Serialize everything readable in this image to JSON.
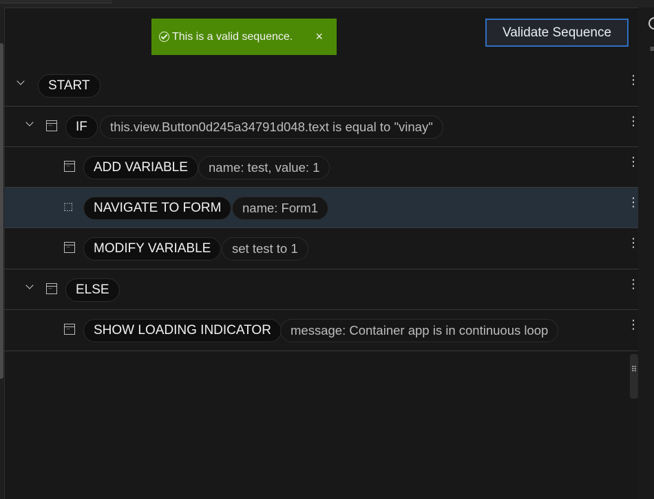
{
  "toast": {
    "message": "This is a valid sequence.",
    "close_glyph": "×",
    "icon": "check-circle-icon",
    "color": "#4c8a06"
  },
  "validate_button": {
    "label": "Validate Sequence",
    "border_color": "#2f6fc4"
  },
  "rows": [
    {
      "name": "START",
      "param": ""
    },
    {
      "name": "IF",
      "param": "this.view.Button0d245a34791d048.text is equal to \"vinay\""
    },
    {
      "name": "ADD VARIABLE",
      "param": "name: test, value: 1"
    },
    {
      "name": "NAVIGATE TO FORM",
      "param": "name: Form1"
    },
    {
      "name": "MODIFY VARIABLE",
      "param": "set test to 1"
    },
    {
      "name": "ELSE",
      "param": ""
    },
    {
      "name": "SHOW LOADING INDICATOR",
      "param": "message: Container app is in continuous loop"
    }
  ],
  "kebab_glyph": "⋮",
  "colors": {
    "background": "#181818",
    "highlight_row": "#25303a"
  }
}
